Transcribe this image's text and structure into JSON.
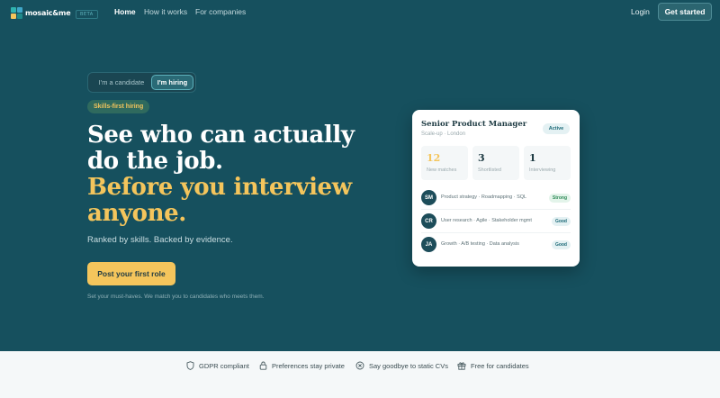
{
  "nav": {
    "logo_text": "mosaic&me",
    "beta": "BETA",
    "links": [
      "Home",
      "How it works",
      "For companies"
    ],
    "login": "Login",
    "cta": "Get started"
  },
  "hero": {
    "toggle": {
      "candidate": "I'm a candidate",
      "hiring": "I'm hiring"
    },
    "pill": "Skills-first hiring",
    "headline_line1": "See who can actually",
    "headline_line2": "do the job.",
    "headline_line3": "Before you interview",
    "headline_line4": "anyone.",
    "subtitle": "Ranked by skills. Backed by evidence.",
    "cta": "Post your first role",
    "note": "Set your must-haves. We match you to candidates who meets them."
  },
  "card": {
    "title": "Senior Product Manager",
    "subtitle": "Scale-up · London",
    "status": "Active",
    "stats": [
      {
        "value": "12",
        "label": "New matches"
      },
      {
        "value": "3",
        "label": "Shortlisted"
      },
      {
        "value": "1",
        "label": "Interviewing"
      }
    ],
    "candidates": [
      {
        "initials": "SM",
        "skills": "Product strategy · Roadmapping · SQL",
        "fit": "Strong"
      },
      {
        "initials": "CR",
        "skills": "User research · Agile · Stakeholder mgmt",
        "fit": "Good"
      },
      {
        "initials": "JA",
        "skills": "Growth · A/B testing · Data analysis",
        "fit": "Good"
      }
    ]
  },
  "features": [
    {
      "icon": "shield-icon",
      "label": "GDPR compliant"
    },
    {
      "icon": "lock-icon",
      "label": "Preferences stay private"
    },
    {
      "icon": "x-circle-icon",
      "label": "Say goodbye to static CVs"
    },
    {
      "icon": "gift-icon",
      "label": "Free for candidates"
    }
  ],
  "colors": {
    "background": "#16505e",
    "accent": "#f4c55c",
    "card": "#ffffff",
    "strip": "#f5f8f9"
  }
}
